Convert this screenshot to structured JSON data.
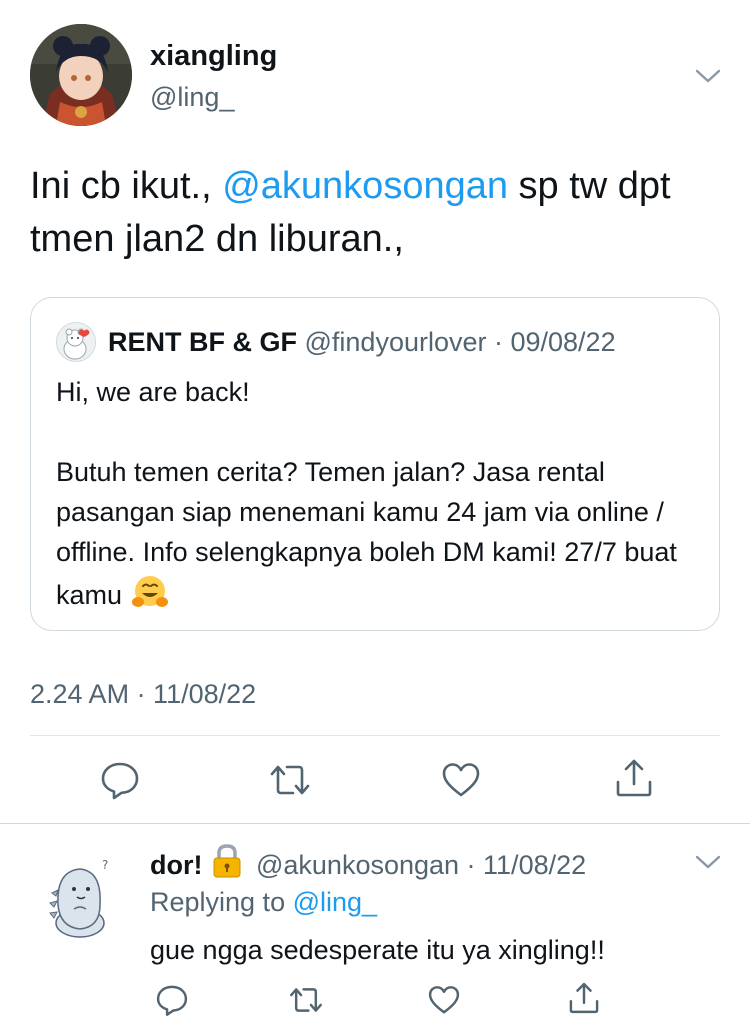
{
  "main_tweet": {
    "display_name": "xiangling",
    "handle": "@ling_",
    "avatar": "character-avatar",
    "text_part1": "Ini cb ikut., ",
    "text_mention": "@akunkosongan",
    "text_part2": " sp tw dpt tmen jlan2 dn liburan.,",
    "timestamp": "2.24 AM · 11/08/22",
    "menu_icon": "chevron-down-icon"
  },
  "quoted_tweet": {
    "display_name": "RENT BF & GF",
    "meta": " @findyourlover · 09/08/22",
    "avatar": "bear-avatar",
    "text": "Hi, we are back!\n\nButuh temen cerita? Temen jalan? Jasa rental pasangan siap menemani kamu 24 jam via online / offline. Info selengkapnya boleh DM kami! 27/7 buat kamu ",
    "emoji": "hugging-face-emoji"
  },
  "actions": [
    {
      "icon": "reply-icon"
    },
    {
      "icon": "retweet-icon"
    },
    {
      "icon": "like-icon"
    },
    {
      "icon": "share-icon"
    }
  ],
  "reply_tweet": {
    "display_name": "dor!",
    "lock_emoji": "locked-emoji",
    "meta": " @akunkosongan · 11/08/22",
    "replying_prefix": "Replying to ",
    "replying_mention": "@ling_",
    "text": "gue ngga sedesperate itu ya xingling!!",
    "avatar": "dinosaur-avatar"
  },
  "colors": {
    "accent": "#1d9bf0",
    "secondary_text": "#536471",
    "border": "#cfd9de"
  }
}
